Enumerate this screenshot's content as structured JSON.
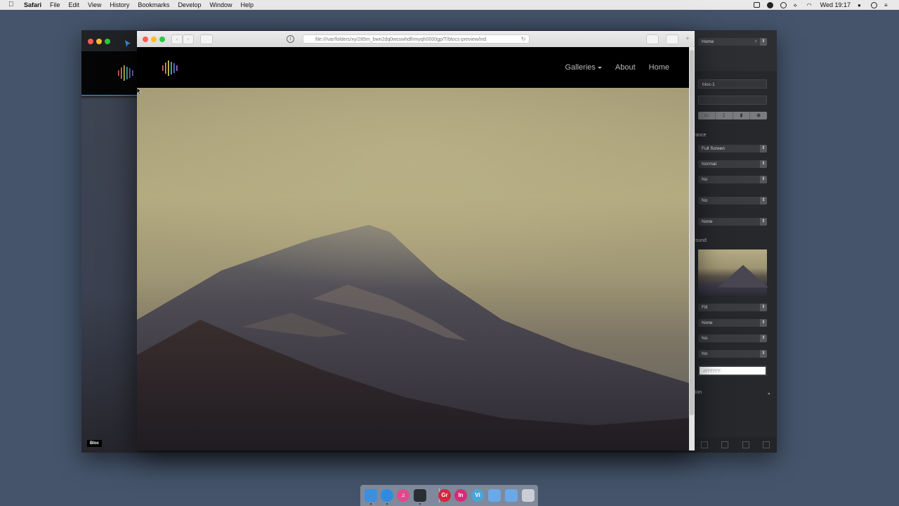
{
  "menubar": {
    "apple_icon": "apple-logo-icon",
    "items": [
      "Safari",
      "File",
      "Edit",
      "View",
      "History",
      "Bookmarks",
      "Develop",
      "Window",
      "Help"
    ],
    "clock": "Wed 19:17",
    "status_icons": [
      "screen-recording-icon",
      "creative-cloud-icon",
      "sync-icon",
      "airdrop-icon",
      "wifi-icon",
      "user-icon",
      "spotlight-icon",
      "notification-center-icon"
    ]
  },
  "blocs": {
    "bloc_label": "Bloc",
    "sidebar": {
      "page_select": "Home",
      "bloc_id": "bloc-1",
      "bloc_class": "",
      "visibility_icons": [
        "desktop-icon",
        "tablet-icon",
        "phone-icon",
        "eye-icon"
      ],
      "appearance_label": "rance",
      "selects": [
        "Full Screen",
        "Normal",
        "No",
        "No",
        "None"
      ],
      "background_label": "round",
      "bg_selects": [
        "Fill",
        "None",
        "No",
        "No"
      ],
      "bg_color_placeholder": "#FFFFFF",
      "animation_label": "tion"
    }
  },
  "safari": {
    "url": "file:///var/folders/xy/285m_bwn2dq0wsswhdlhmyqh0000gp/T/blocs-preview/ind",
    "nav": {
      "galleries": "Galleries",
      "about": "About",
      "home": "Home"
    }
  },
  "dock": {
    "items": [
      {
        "name": "finder",
        "color": "#3b8fe0",
        "text": ""
      },
      {
        "name": "safari",
        "color": "#2f8be0",
        "text": ""
      },
      {
        "name": "itunes",
        "color": "#e04a8c",
        "text": "♫"
      },
      {
        "name": "blocs",
        "color": "#2a2d33",
        "text": ""
      },
      {
        "name": "graphicriver",
        "color": "#d7263d",
        "text": "Gr"
      },
      {
        "name": "invision",
        "color": "#d62c77",
        "text": "In"
      },
      {
        "name": "vimeo",
        "color": "#4aa5d8",
        "text": "Vi"
      },
      {
        "name": "applications-folder",
        "color": "#6aa9e8",
        "text": ""
      },
      {
        "name": "downloads-folder",
        "color": "#6aa9e8",
        "text": ""
      },
      {
        "name": "trash",
        "color": "#c9ced6",
        "text": ""
      }
    ]
  }
}
